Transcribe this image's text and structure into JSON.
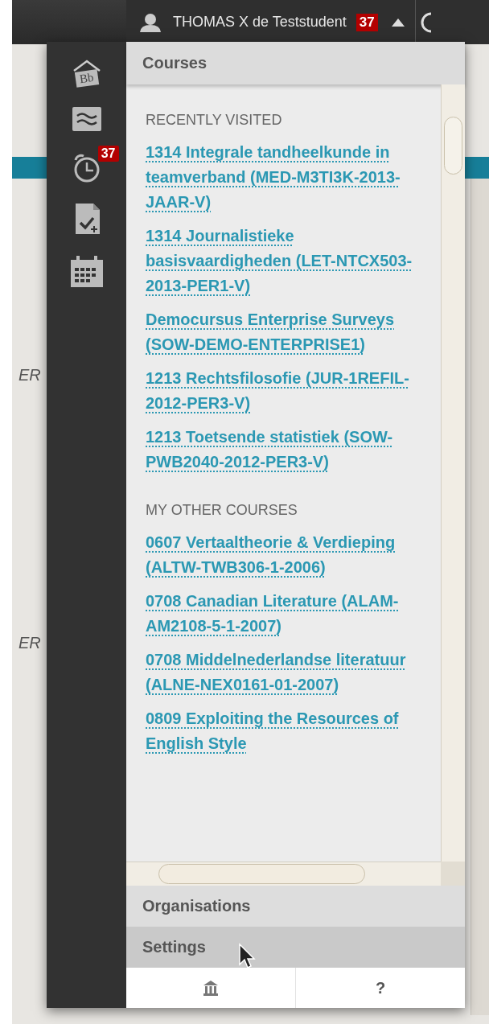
{
  "top_bar": {
    "user_name": "THOMAS X de Teststudent",
    "badge": "37"
  },
  "background": {
    "fragments": [
      "ER",
      "ER"
    ]
  },
  "sidebar": {
    "items": [
      {
        "kind": "home",
        "label": "Bb"
      },
      {
        "kind": "stream"
      },
      {
        "kind": "due",
        "badge": "37"
      },
      {
        "kind": "grades"
      },
      {
        "kind": "calendar"
      }
    ]
  },
  "panel": {
    "title": "Courses",
    "sections": [
      {
        "heading": "RECENTLY VISITED",
        "courses": [
          "1314 Integrale tandheelkunde in teamverband (MED-M3TI3K-2013-JAAR-V)",
          "1314 Journalistieke basisvaardigheden (LET-NTCX503-2013-PER1-V)",
          "Democursus Enterprise Surveys (SOW-DEMO-ENTERPRISE1)",
          "1213 Rechtsfilosofie (JUR-1REFIL-2012-PER3-V)",
          "1213 Toetsende statistiek (SOW-PWB2040-2012-PER3-V)"
        ]
      },
      {
        "heading": "MY OTHER COURSES",
        "courses": [
          "0607 Vertaaltheorie & Verdieping (ALTW-TWB306-1-2006)",
          "0708 Canadian Literature (ALAM-AM2108-5-1-2007)",
          "0708 Middelnederlandse literatuur (ALNE-NEX0161-01-2007)",
          "0809 Exploiting the Resources of English Style"
        ]
      }
    ],
    "menu": [
      {
        "label": "Organisations",
        "selected": false
      },
      {
        "label": "Settings",
        "selected": true
      }
    ],
    "footer": [
      {
        "kind": "institution"
      },
      {
        "kind": "help",
        "label": "?"
      }
    ]
  }
}
